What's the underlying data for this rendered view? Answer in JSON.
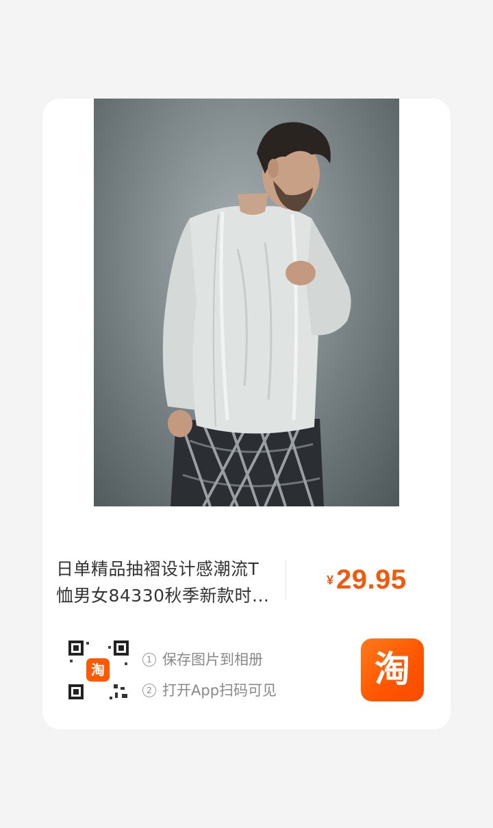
{
  "product": {
    "title_line1": "日单精品抽褶设计感潮流T",
    "title_line2": "恤男女84330秋季新款时...",
    "price_currency": "¥",
    "price_value": "29.95"
  },
  "share": {
    "step1_num": "1",
    "step1_label": "保存图片到相册",
    "step2_num": "2",
    "step2_label": "打开App扫码可见",
    "qr_center_logo_text": "淘",
    "app_logo_text": "淘"
  },
  "colors": {
    "price": "#f05a0c",
    "brand_orange": "#ff5500",
    "background": "#f4f4f4",
    "card": "#ffffff"
  },
  "icons": {
    "qr": "qr-code-icon",
    "app": "taobao-app-icon"
  }
}
